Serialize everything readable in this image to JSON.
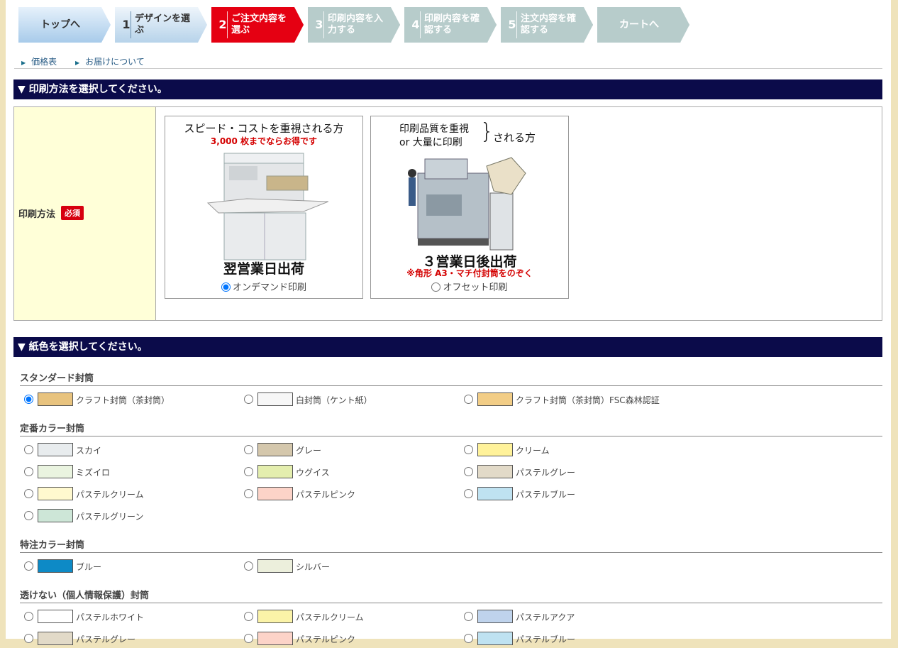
{
  "steps": [
    {
      "num": "",
      "label": "トップへ",
      "state": "top"
    },
    {
      "num": "1",
      "label": "デザインを選ぶ",
      "state": "done"
    },
    {
      "num": "2",
      "label": "ご注文内容を選ぶ",
      "state": "current"
    },
    {
      "num": "3",
      "label": "印刷内容を入力する",
      "state": "off"
    },
    {
      "num": "4",
      "label": "印刷内容を確認する",
      "state": "off"
    },
    {
      "num": "5",
      "label": "注文内容を確認する",
      "state": "off"
    },
    {
      "num": "",
      "label": "カートへ",
      "state": "cart"
    }
  ],
  "links": {
    "price": "価格表",
    "delivery": "お届けについて"
  },
  "print_section": {
    "heading": "▼ 印刷方法を選択してください。",
    "label": "印刷方法",
    "required": "必須",
    "ondemand": {
      "line1": "スピード・コストを重視される方",
      "line2": "3,000 枚までならお得です",
      "ship": "翌営業日出荷",
      "option": "オンデマンド印刷",
      "selected": true
    },
    "offset": {
      "line1a": "印刷品質を重視",
      "line1b": "or 大量に印刷",
      "line1c": "される方",
      "ship": "３営業日後出荷",
      "note": "※角形 A3・マチ付封筒をのぞく",
      "option": "オフセット印刷",
      "selected": false
    }
  },
  "paper_section": {
    "heading": "▼ 紙色を選択してください。",
    "groups": [
      {
        "title": "スタンダード封筒",
        "items": [
          {
            "name": "クラフト封筒（茶封筒）",
            "color": "#e8c37e",
            "checked": true
          },
          {
            "name": "白封筒（ケント紙）",
            "color": "#f7f7f7",
            "checked": false
          },
          {
            "name": "クラフト封筒（茶封筒）FSC森林認証",
            "color": "#f2cd86",
            "checked": false
          }
        ]
      },
      {
        "title": "定番カラー封筒",
        "items": [
          {
            "name": "スカイ",
            "color": "#e8ecee",
            "checked": false
          },
          {
            "name": "グレー",
            "color": "#d4c7ac",
            "checked": false
          },
          {
            "name": "クリーム",
            "color": "#fff29a",
            "checked": false
          },
          {
            "name": "ミズイロ",
            "color": "#eaf4e0",
            "checked": false
          },
          {
            "name": "ウグイス",
            "color": "#e4eeae",
            "checked": false
          },
          {
            "name": "パステルグレー",
            "color": "#e2dac8",
            "checked": false
          },
          {
            "name": "パステルクリーム",
            "color": "#fff9cf",
            "checked": false
          },
          {
            "name": "パステルピンク",
            "color": "#fcd3c8",
            "checked": false
          },
          {
            "name": "パステルブルー",
            "color": "#bfe2f1",
            "checked": false
          },
          {
            "name": "パステルグリーン",
            "color": "#cde6d7",
            "checked": false
          }
        ]
      },
      {
        "title": "特注カラー封筒",
        "items": [
          {
            "name": "ブルー",
            "color": "#0d8ac6",
            "checked": false
          },
          {
            "name": "シルバー",
            "color": "#ecefdc",
            "checked": false
          }
        ]
      },
      {
        "title": "透けない（個人情報保護）封筒",
        "items": [
          {
            "name": "パステルホワイト",
            "color": "#ffffff",
            "checked": false
          },
          {
            "name": "パステルクリーム",
            "color": "#fbf3a8",
            "checked": false
          },
          {
            "name": "パステルアクア",
            "color": "#bfd3ec",
            "checked": false
          },
          {
            "name": "パステルグレー",
            "color": "#e2dac8",
            "checked": false
          },
          {
            "name": "パステルピンク",
            "color": "#fcd3c8",
            "checked": false
          },
          {
            "name": "パステルブルー",
            "color": "#bfe2f1",
            "checked": false
          }
        ]
      }
    ]
  }
}
